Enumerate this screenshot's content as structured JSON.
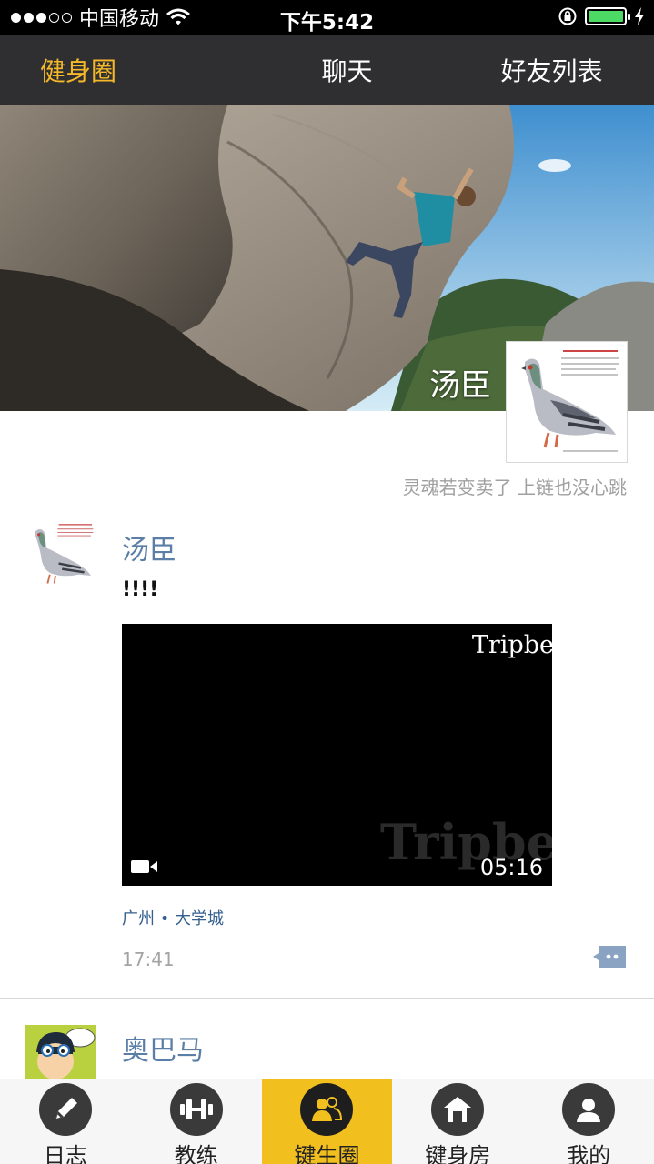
{
  "status_bar": {
    "carrier": "中国移动",
    "time": "下午5:42"
  },
  "top_tabs": [
    {
      "label": "健身圈",
      "active": true
    },
    {
      "label": "聊天",
      "active": false
    },
    {
      "label": "好友列表",
      "active": false
    }
  ],
  "profile": {
    "name": "汤臣",
    "signature": "灵魂若变卖了 上链也没心跳"
  },
  "post": {
    "user": "汤臣",
    "text": "!!!!",
    "video": {
      "watermark": "Tripbe",
      "duration": "05:16"
    },
    "location": "广州 • 大学城",
    "time": "17:41"
  },
  "post2": {
    "user": "奥巴马"
  },
  "bottom_nav": [
    {
      "label": "日志",
      "icon": "pencil-icon",
      "active": false
    },
    {
      "label": "教练",
      "icon": "dumbbell-icon",
      "active": false
    },
    {
      "label": "键生圈",
      "icon": "group-icon",
      "active": true
    },
    {
      "label": "键身房",
      "icon": "gym-house-icon",
      "active": false
    },
    {
      "label": "我的",
      "icon": "user-icon",
      "active": false
    }
  ],
  "colors": {
    "accent": "#f4b829",
    "tabbar_bg": "#2f2f31",
    "link_blue": "#5a7ea6",
    "nav_active_bg": "#f2c01e"
  }
}
